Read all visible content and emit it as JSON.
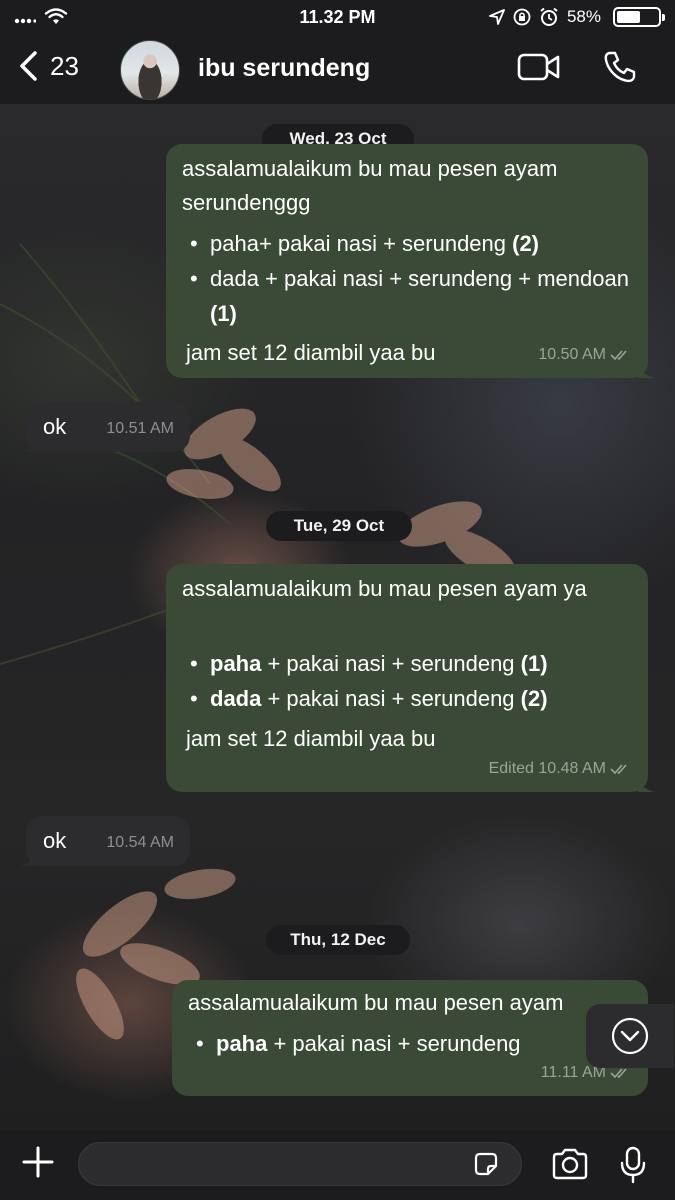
{
  "status_bar": {
    "time": "11.32 PM",
    "battery_text": "58%",
    "battery_level": 0.58
  },
  "header": {
    "back_count": "23",
    "contact_name": "ibu serundeng"
  },
  "messages": [
    {
      "date_chip": "Wed, 23 Oct"
    },
    {
      "direction": "out",
      "intro": "assalamualaikum bu mau pesen ayam serundenggg",
      "items": [
        {
          "text": "paha+ pakai nasi + serundeng ",
          "bold_suffix": "(2)"
        },
        {
          "text": "dada + pakai nasi + serundeng + mendoan ",
          "bold_suffix": "(1)"
        }
      ],
      "footer": "jam set 12 diambil yaa bu",
      "time": "10.50 AM"
    },
    {
      "direction": "in",
      "text": "ok",
      "time": "10.51 AM"
    },
    {
      "date_chip": "Tue, 29 Oct"
    },
    {
      "direction": "out",
      "intro": "assalamualaikum bu mau pesen ayam ya",
      "items": [
        {
          "bold_prefix": "paha",
          "text": " + pakai nasi + serundeng ",
          "bold_suffix": "(1)"
        },
        {
          "bold_prefix": "dada",
          "text": " + pakai nasi + serundeng ",
          "bold_suffix": "(2)"
        }
      ],
      "footer": "jam set 12 diambil yaa bu",
      "time": "Edited 10.48 AM"
    },
    {
      "direction": "in",
      "text": "ok",
      "time": "10.54 AM"
    },
    {
      "date_chip": "Thu, 12 Dec"
    },
    {
      "direction": "out",
      "intro": "assalamualaikum bu mau pesen ayam",
      "items": [
        {
          "bold_prefix": "paha",
          "text": " + pakai nasi + serundeng"
        }
      ],
      "time": "11.11 AM"
    }
  ],
  "input": {
    "placeholder": "",
    "value": ""
  },
  "colors": {
    "outgoing_bubble": "#3a4a36",
    "incoming_bubble": "#2c2c2e",
    "bars": "#1c1c1e"
  },
  "icons": [
    "wifi-icon",
    "location-icon",
    "lock-rotation-icon",
    "alarm-icon",
    "back-chevron-icon",
    "video-call-icon",
    "phone-icon",
    "double-check-icon",
    "chevron-down-icon",
    "plus-icon",
    "sticker-icon",
    "camera-icon",
    "mic-icon"
  ]
}
